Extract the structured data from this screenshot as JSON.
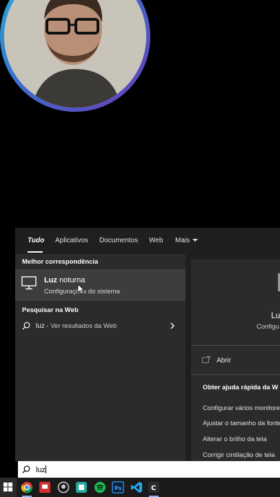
{
  "tabs": {
    "items": [
      {
        "label": "Tudo"
      },
      {
        "label": "Aplicativos"
      },
      {
        "label": "Documentos"
      },
      {
        "label": "Web"
      },
      {
        "label": "Mais"
      }
    ]
  },
  "results": {
    "best_match_heading": "Melhor correspondência",
    "best_match": {
      "title_bold": "Luz",
      "title_rest": " noturna",
      "subtitle": "Configurações do sistema"
    },
    "web_heading": "Pesquisar na Web",
    "web_item": {
      "query": "luz",
      "suffix": " - Ver resultados da Web"
    }
  },
  "preview": {
    "title": "Luz",
    "subtitle": "Configu",
    "open_label": "Abrir",
    "help_title": "Obter ajuda rápida da W",
    "help_links": [
      "Configurar vários monitores",
      "Ajustar o tamanho da fonte",
      "Alterar o brilho da tela",
      "Corrigir cintilação de tela"
    ]
  },
  "search_box": {
    "value": "luz"
  },
  "taskbar": {
    "icons": [
      "windows-start-icon",
      "chrome-icon",
      "red-app-icon",
      "github-icon",
      "green-app-icon",
      "spotify-icon",
      "photoshop-icon",
      "vscode-icon",
      "c-app-icon"
    ]
  },
  "colors": {
    "panel": "#1f1f1f",
    "column": "#2b2b2b",
    "highlight": "#3d3d3d",
    "webcam_ring_start": "#22b7d6",
    "webcam_ring_end": "#6a3bb8"
  }
}
